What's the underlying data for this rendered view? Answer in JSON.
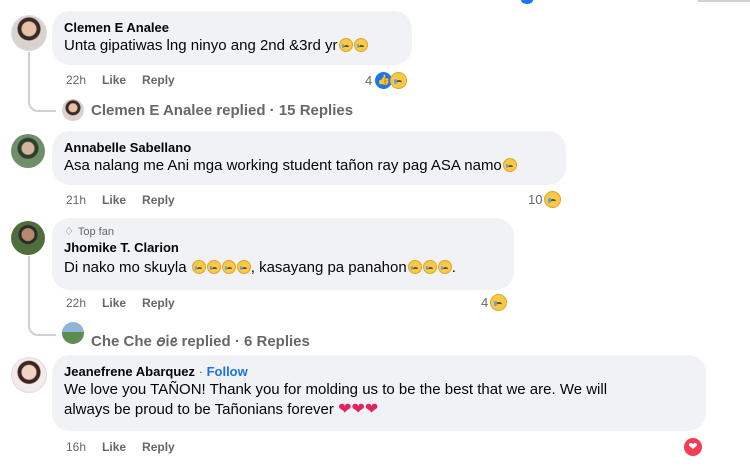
{
  "comments": [
    {
      "author": "Clemen E Analee",
      "text": "Unta gipatiwas lng ninyo ang 2nd &3rd yr",
      "time": "22h",
      "like_label": "Like",
      "reply_label": "Reply",
      "reaction_count": "4",
      "reaction_icons": [
        "like-icon",
        "crying-face-icon"
      ],
      "replies_summary": "Clemen E Analee replied · 15 Replies"
    },
    {
      "author": "Annabelle Sabellano",
      "text": "Asa nalang me Ani mga working student tañon ray pag ASA namo",
      "time": "21h",
      "like_label": "Like",
      "reply_label": "Reply",
      "reaction_count": "10",
      "reaction_icons": [
        "crying-face-icon"
      ]
    },
    {
      "badge": "Top fan",
      "author": "Jhomike T. Clarion",
      "text_before": "Di nako mo skuyla",
      "text_after": ", kasayang pa panahon",
      "time": "22h",
      "like_label": "Like",
      "reply_label": "Reply",
      "reaction_count": "4",
      "reaction_icons": [
        "crying-face-icon"
      ],
      "replies_summary": "Che Che ꪮᎥꫀ replied · 6 Replies"
    },
    {
      "author": "Jeanefrene Abarquez",
      "follow_label": "Follow",
      "text_line1": "We love you TAÑON! Thank you for molding us to be the best that we are. We will",
      "text_line2": "always be proud to be Tañonians forever",
      "time": "16h",
      "like_label": "Like",
      "reply_label": "Reply",
      "reaction_icons": [
        "heart-icon"
      ]
    }
  ],
  "colors": {
    "bubble": "#f0f2f5",
    "meta_text": "#65676b",
    "link_blue": "#1b74e4",
    "like_blue": "#1877f2",
    "heart_red": "#f33e58"
  }
}
